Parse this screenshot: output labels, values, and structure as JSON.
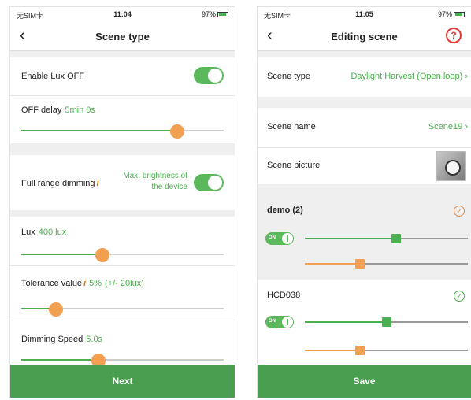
{
  "left": {
    "status": {
      "carrier": "无SIM卡",
      "time": "11:04",
      "battery": "97%"
    },
    "nav": {
      "back": "‹",
      "title": "Scene type"
    },
    "enable_lux_off": {
      "label": "Enable Lux OFF",
      "on": true
    },
    "off_delay": {
      "label": "OFF delay",
      "value": "5min 0s",
      "level": 0.77
    },
    "full_range": {
      "label": "Full range dimming",
      "info": "i",
      "note_line1": "Max. brightness of",
      "note_line2": "the device",
      "on": true
    },
    "lux": {
      "label": "Lux",
      "value": "400 lux",
      "level": 0.4
    },
    "tolerance": {
      "label": "Tolerance value",
      "info": "i",
      "value": "5%",
      "extra": "(+/- 20lux)",
      "level": 0.17
    },
    "dimming_speed": {
      "label": "Dimming Speed",
      "value": "5.0s",
      "level": 0.38
    },
    "next_label": "Next"
  },
  "right": {
    "status": {
      "carrier": "无SIM卡",
      "time": "11:05",
      "battery": "97%"
    },
    "nav": {
      "back": "‹",
      "title": "Editing scene",
      "help": "?"
    },
    "scene_type": {
      "label": "Scene type",
      "value": "Daylight Harvest (Open loop) ›"
    },
    "scene_name": {
      "label": "Scene name",
      "value": "Scene19 ›"
    },
    "scene_picture": {
      "label": "Scene picture"
    },
    "groups": [
      {
        "name": "demo (2)",
        "toggle": "ON",
        "brightness": 0.56,
        "color_temp": 0.34,
        "check": "✓"
      },
      {
        "name": "HCD038",
        "toggle": "ON",
        "brightness": 0.5,
        "color_temp": 0.34,
        "check": "✓"
      }
    ],
    "save_label": "Save"
  },
  "colors": {
    "accent": "#4a9e4f",
    "thumb": "#f0a050",
    "info": "#e57300",
    "danger": "#e53935"
  }
}
